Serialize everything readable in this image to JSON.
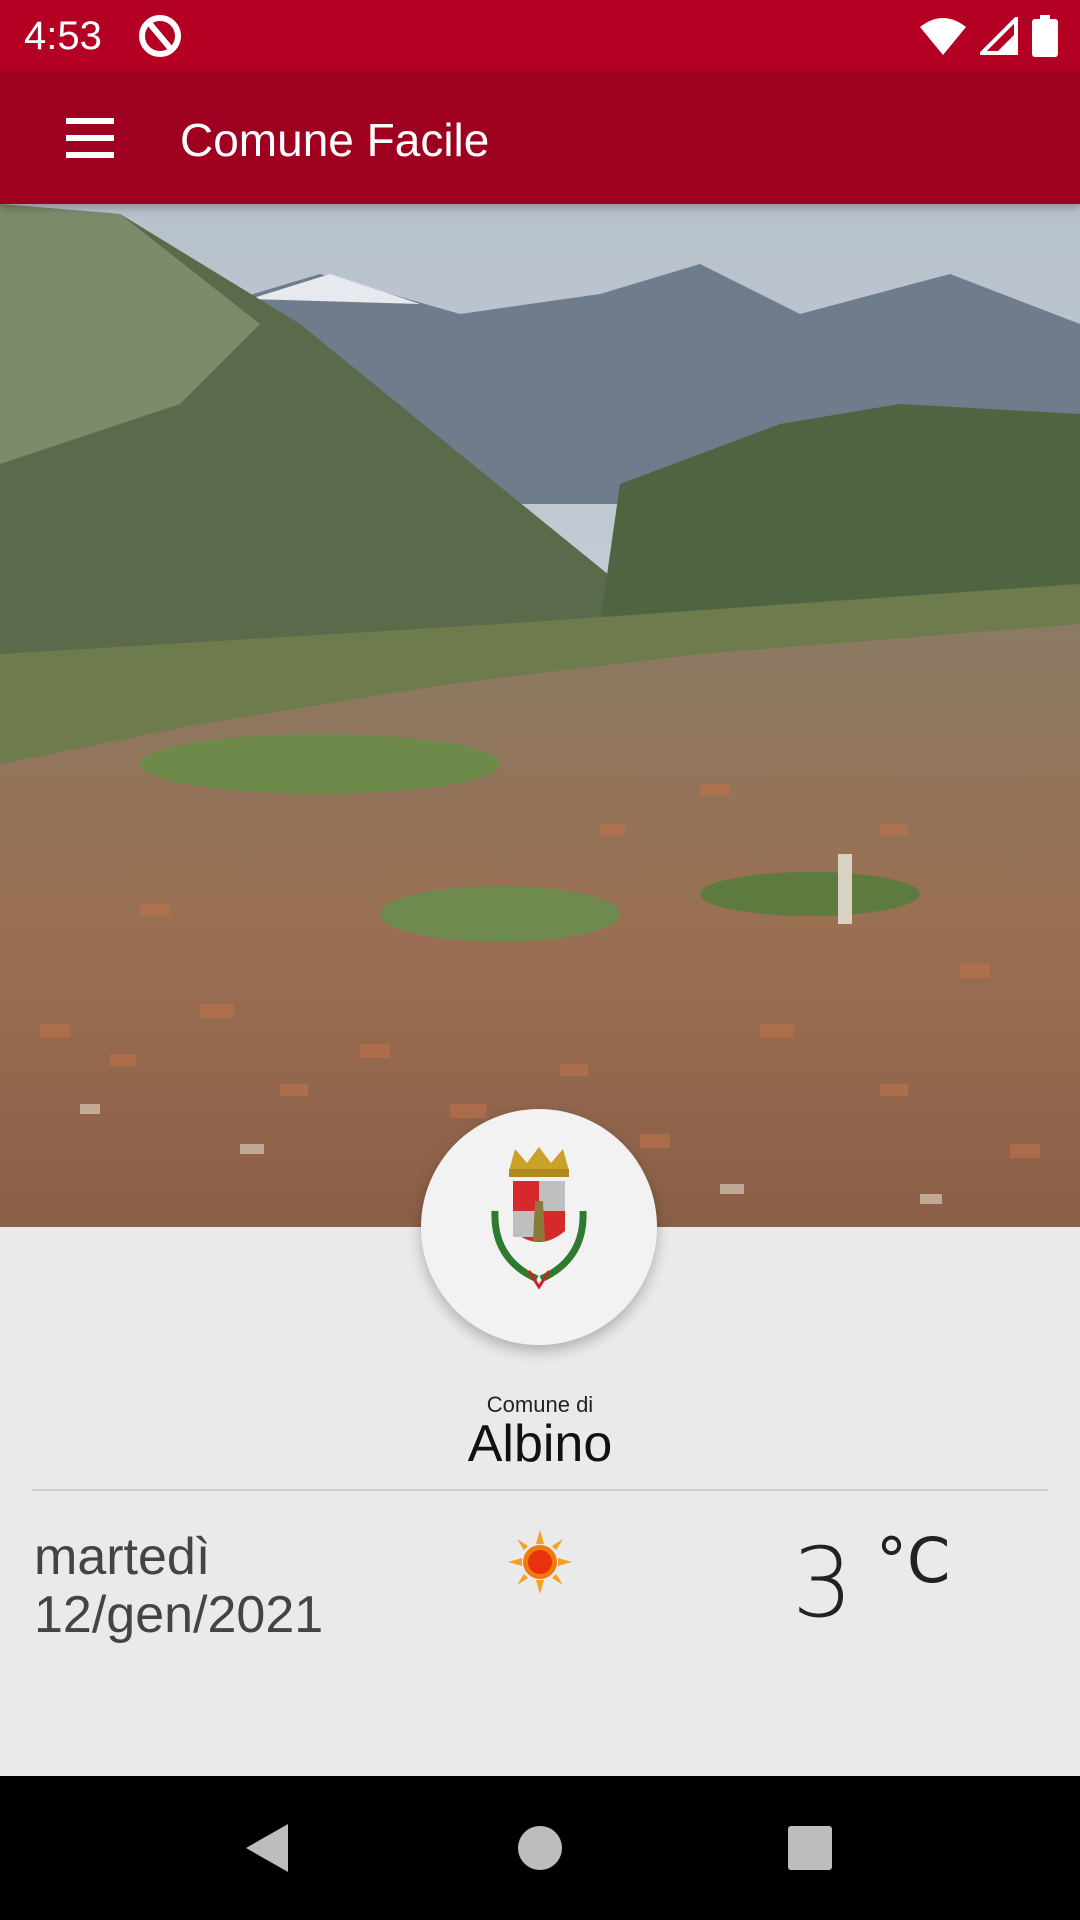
{
  "status_bar": {
    "time": "4:53",
    "icons": [
      "app-status-icon",
      "wifi-icon",
      "signal-icon",
      "battery-icon"
    ]
  },
  "app_bar": {
    "title": "Comune Facile",
    "menu_icon": "hamburger-menu-icon",
    "background": "#a0001f"
  },
  "hero": {
    "description_icon": "landscape-photo"
  },
  "emblem": {
    "icon": "coat-of-arms-icon"
  },
  "comune": {
    "label": "Comune di",
    "name": "Albino"
  },
  "weather": {
    "day": "martedì",
    "date": "12/gen/2021",
    "icon": "sun-icon",
    "temperature": "3",
    "unit": "°C"
  },
  "nav_bar": {
    "buttons": [
      "back-icon",
      "home-icon",
      "recents-icon"
    ]
  },
  "colors": {
    "status_bar": "#b40022",
    "app_bar": "#a0001f",
    "body_bg": "#eaeaea"
  }
}
